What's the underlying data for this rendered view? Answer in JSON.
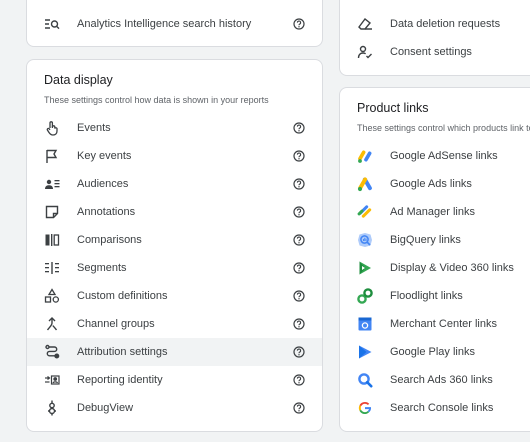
{
  "top_left": {
    "items": [
      {
        "label": "Analytics Intelligence search history",
        "icon": "search-history-icon"
      }
    ]
  },
  "top_right": {
    "items": [
      {
        "label": "Data deletion requests",
        "icon": "eraser-icon"
      },
      {
        "label": "Consent settings",
        "icon": "consent-icon"
      }
    ]
  },
  "data_display": {
    "title": "Data display",
    "subtitle": "These settings control how data is shown in your reports",
    "items": [
      {
        "label": "Events",
        "icon": "touch-icon"
      },
      {
        "label": "Key events",
        "icon": "flag-icon"
      },
      {
        "label": "Audiences",
        "icon": "audience-icon"
      },
      {
        "label": "Annotations",
        "icon": "annotation-icon"
      },
      {
        "label": "Comparisons",
        "icon": "comparison-icon"
      },
      {
        "label": "Segments",
        "icon": "segments-icon"
      },
      {
        "label": "Custom definitions",
        "icon": "shapes-icon"
      },
      {
        "label": "Channel groups",
        "icon": "merge-icon"
      },
      {
        "label": "Attribution settings",
        "icon": "route-icon"
      },
      {
        "label": "Reporting identity",
        "icon": "identity-icon"
      },
      {
        "label": "DebugView",
        "icon": "debug-icon"
      }
    ],
    "highlighted_index": 8
  },
  "product_links": {
    "title": "Product links",
    "subtitle": "These settings control which products link to",
    "items": [
      {
        "label": "Google AdSense links",
        "icon": "adsense-icon"
      },
      {
        "label": "Google Ads links",
        "icon": "google-ads-icon"
      },
      {
        "label": "Ad Manager links",
        "icon": "ad-manager-icon"
      },
      {
        "label": "BigQuery links",
        "icon": "bigquery-icon"
      },
      {
        "label": "Display & Video 360 links",
        "icon": "dv360-icon"
      },
      {
        "label": "Floodlight links",
        "icon": "floodlight-icon"
      },
      {
        "label": "Merchant Center links",
        "icon": "merchant-center-icon"
      },
      {
        "label": "Google Play links",
        "icon": "google-play-icon"
      },
      {
        "label": "Search Ads 360 links",
        "icon": "search-ads-360-icon"
      },
      {
        "label": "Search Console links",
        "icon": "search-console-icon"
      }
    ]
  },
  "colors": {
    "background": "#f1f3f4",
    "card": "#ffffff",
    "border": "#dadce0",
    "text": "#3c4043",
    "muted": "#5f6368",
    "highlight": "#f1f3f4",
    "google_blue": "#4285f4",
    "google_red": "#ea4335",
    "google_yellow": "#fbbc04",
    "google_green": "#34a853"
  }
}
